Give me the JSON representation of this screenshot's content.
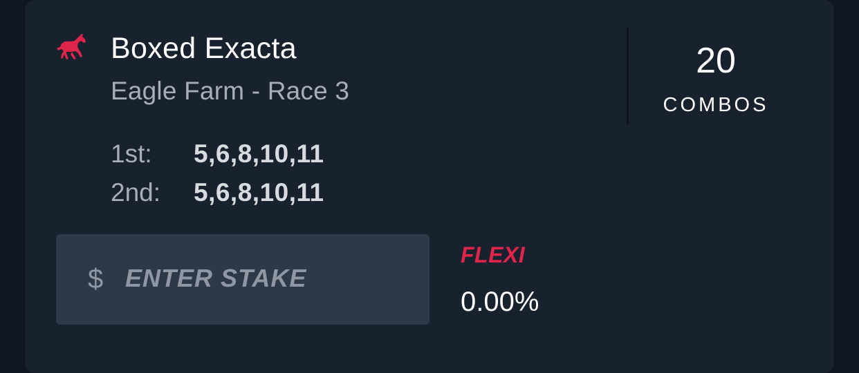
{
  "bet": {
    "type": "Boxed Exacta",
    "race": "Eagle Farm - Race 3",
    "icon": "horse-icon",
    "accent_color": "#e0254a"
  },
  "combos": {
    "count": "20",
    "label": "COMBOS"
  },
  "selections": [
    {
      "position": "1st:",
      "runners": "5,6,8,10,11"
    },
    {
      "position": "2nd:",
      "runners": "5,6,8,10,11"
    }
  ],
  "stake": {
    "currency_symbol": "$",
    "placeholder": "ENTER STAKE",
    "value": ""
  },
  "flexi": {
    "label": "FLEXI",
    "value": "0.00%"
  }
}
